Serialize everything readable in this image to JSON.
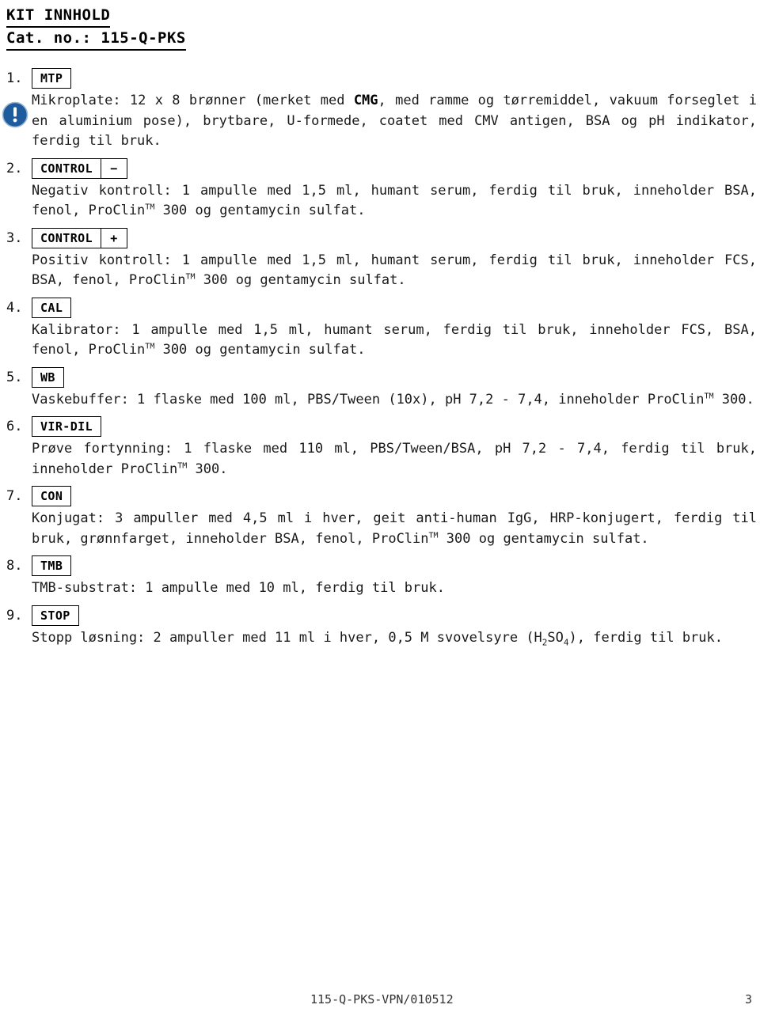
{
  "document": {
    "title": "KIT INNHOLD",
    "catalog_line": "Cat. no.: 115-Q-PKS"
  },
  "warning_icon": {
    "name": "exclamation-circle-icon",
    "color": "#1F5C9E",
    "glyph": "!"
  },
  "items": [
    {
      "number": "1.",
      "tag": "MTP",
      "sign": "",
      "body_html": "Mikroplate: 12 x 8 brønner (merket med <b>CMG</b>, med ramme og tørremiddel, vakuum forseglet i en aluminium pose), brytbare, U-formede, coatet med CMV antigen, BSA og pH indikator, ferdig til bruk."
    },
    {
      "number": "2.",
      "tag": "CONTROL",
      "sign": "−",
      "body_html": "Negativ kontroll: 1 ampulle med 1,5 ml, humant serum, ferdig til bruk, inneholder BSA, fenol, ProClin<sup>TM</sup> 300 og gentamycin sulfat."
    },
    {
      "number": "3.",
      "tag": "CONTROL",
      "sign": "+",
      "body_html": "Positiv kontroll: 1 ampulle med 1,5 ml, humant serum, ferdig til bruk, inneholder FCS, BSA, fenol, ProClin<sup>TM</sup> 300 og gentamycin sulfat."
    },
    {
      "number": "4.",
      "tag": "CAL",
      "sign": "",
      "body_html": "Kalibrator: 1 ampulle med 1,5 ml, humant serum, ferdig til bruk, inneholder FCS, BSA, fenol, ProClin<sup>TM</sup> 300 og gentamycin sulfat."
    },
    {
      "number": "5.",
      "tag": "WB",
      "sign": "",
      "body_html": "Vaskebuffer: 1 flaske med 100 ml, PBS/Tween (10x), pH 7,2 - 7,4, inneholder ProClin<sup>TM</sup> 300."
    },
    {
      "number": "6.",
      "tag": "VIR-DIL",
      "sign": "",
      "body_html": "Prøve fortynning: 1 flaske med 110 ml, PBS/Tween/BSA, pH 7,2 - 7,4, ferdig til bruk, inneholder ProClin<sup>TM</sup> 300."
    },
    {
      "number": "7.",
      "tag": "CON",
      "sign": "",
      "body_html": "Konjugat: 3 ampuller med 4,5 ml i hver, geit anti-human IgG, HRP-konjugert, ferdig til bruk, grønnfarget, inneholder BSA, fenol, ProClin<sup>TM</sup> 300 og gentamycin sulfat."
    },
    {
      "number": "8.",
      "tag": "TMB",
      "sign": "",
      "body_html": "TMB-substrat: 1 ampulle med 10 ml, ferdig til bruk."
    },
    {
      "number": "9.",
      "tag": "STOP",
      "sign": "",
      "body_html": "Stopp løsning: 2 ampuller med 11 ml i hver, 0,5 M svovelsyre (H<sub>2</sub>SO<sub>4</sub>), ferdig til bruk."
    }
  ],
  "footer": {
    "code": "115-Q-PKS-VPN/010512",
    "page_number": "3"
  }
}
